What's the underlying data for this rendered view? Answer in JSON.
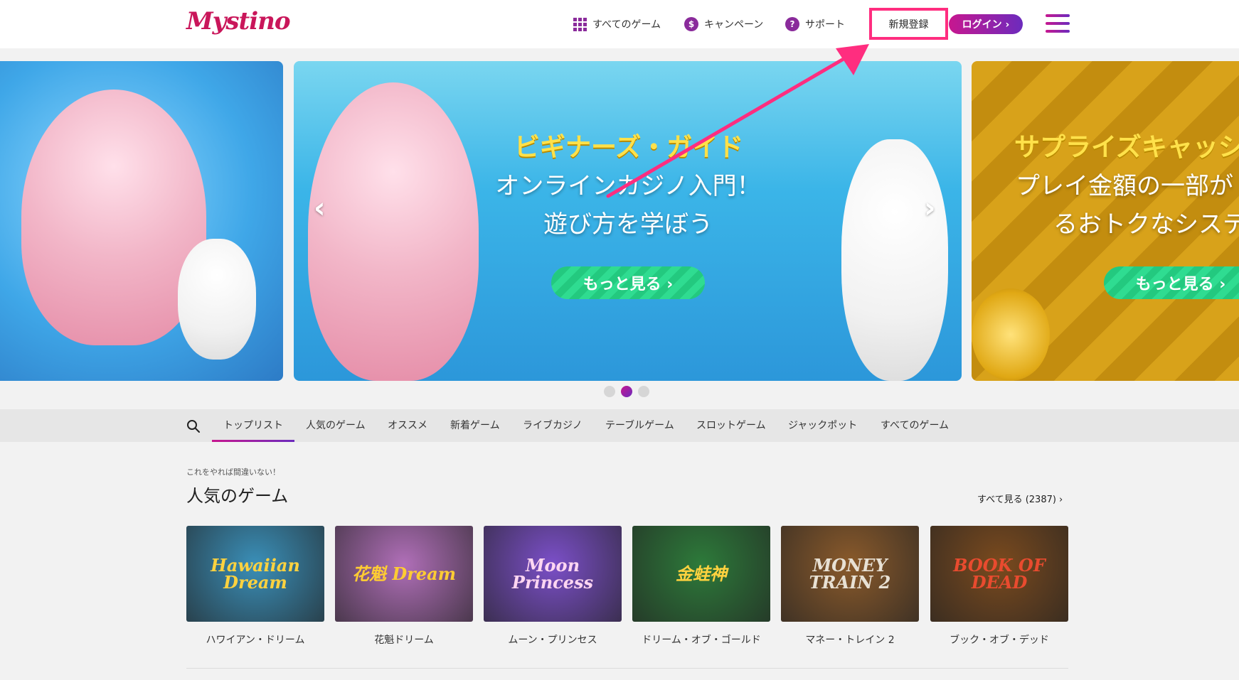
{
  "header": {
    "logo": "Mystino",
    "nav": [
      {
        "label": "すべてのゲーム",
        "icon": "grid-icon"
      },
      {
        "label": "キャンペーン",
        "icon": "dollar-icon"
      },
      {
        "label": "サポート",
        "icon": "question-icon"
      }
    ],
    "signup_label": "新規登録",
    "login_label": "ログイン ›"
  },
  "carousel": {
    "main": {
      "title": "ビギナーズ・ガイド",
      "line1": "オンラインカジノ入門！",
      "line2": "遊び方を学ぼう",
      "cta": "もっと見る ›"
    },
    "right": {
      "title": "サプライズキャッシ",
      "line1": "プレイ金額の一部が",
      "line2": "るおトクなシステ",
      "cta": "もっと見る ›"
    },
    "prev_icon": "‹",
    "next_icon": "›"
  },
  "tabs": [
    "トップリスト",
    "人気のゲーム",
    "オススメ",
    "新着ゲーム",
    "ライブカジノ",
    "テーブルゲーム",
    "スロットゲーム",
    "ジャックポット",
    "すべてのゲーム"
  ],
  "section": {
    "subtitle": "これをやれば間違いない！",
    "title": "人気のゲーム",
    "see_all": "すべて見る (2387) ›"
  },
  "games": [
    {
      "logo": "Hawaiian Dream",
      "name": "ハワイアン・ドリーム",
      "bg": "#3a8fb8",
      "fg": "#ffd23f"
    },
    {
      "logo": "花魁 Dream",
      "name": "花魁ドリーム",
      "bg": "#b06fb8",
      "fg": "#ffcc33"
    },
    {
      "logo": "Moon Princess",
      "name": "ムーン・プリンセス",
      "bg": "#7b4fc8",
      "fg": "#ffd6f2"
    },
    {
      "logo": "金蛙神",
      "name": "ドリーム・オブ・ゴールド",
      "bg": "#2d7a3a",
      "fg": "#ffd23f"
    },
    {
      "logo": "MONEY TRAIN 2",
      "name": "マネー・トレイン 2",
      "bg": "#8a5a2b",
      "fg": "#e8e1d4"
    },
    {
      "logo": "BOOK OF DEAD",
      "name": "ブック・オブ・デッド",
      "bg": "#7a4a1e",
      "fg": "#e94b2f"
    }
  ]
}
